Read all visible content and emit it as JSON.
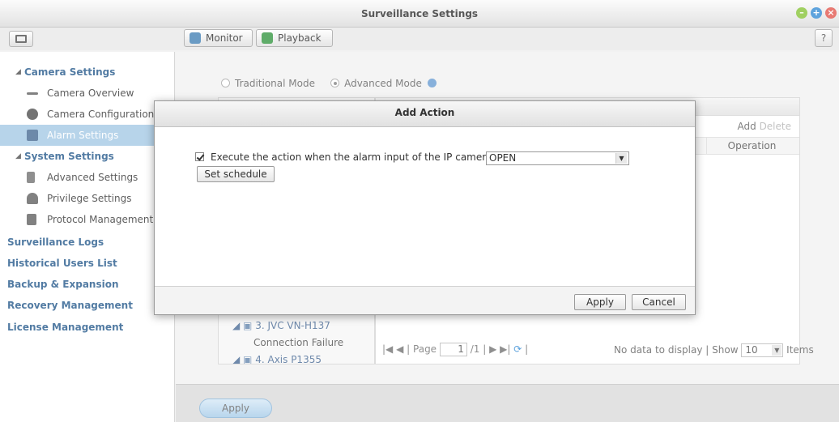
{
  "window": {
    "title": "Surveillance Settings",
    "help_label": "?"
  },
  "toolbar": {
    "monitor_label": "Monitor",
    "playback_label": "Playback"
  },
  "sidebar": {
    "items": [
      {
        "label": "Camera Settings",
        "kind": "group"
      },
      {
        "label": "Camera Overview",
        "kind": "child",
        "icon": "list-icon"
      },
      {
        "label": "Camera Configuration",
        "kind": "child",
        "icon": "camera-icon"
      },
      {
        "label": "Alarm Settings",
        "kind": "child",
        "icon": "alarm-icon",
        "active": true
      },
      {
        "label": "System Settings",
        "kind": "group"
      },
      {
        "label": "Advanced Settings",
        "kind": "child",
        "icon": "wrench-icon"
      },
      {
        "label": "Privilege Settings",
        "kind": "child",
        "icon": "user-icon"
      },
      {
        "label": "Protocol Management",
        "kind": "child",
        "icon": "network-icon"
      },
      {
        "label": "Surveillance Logs",
        "kind": "top"
      },
      {
        "label": "Historical Users List",
        "kind": "top"
      },
      {
        "label": "Backup & Expansion",
        "kind": "top"
      },
      {
        "label": "Recovery Management",
        "kind": "top"
      },
      {
        "label": "License Management",
        "kind": "top"
      }
    ]
  },
  "main": {
    "mode_traditional": "Traditional Mode",
    "mode_advanced": "Advanced Mode",
    "add_label": "Add",
    "delete_label": "Delete",
    "operation_header": "Operation",
    "tree": {
      "camera3": "3. JVC VN-H137",
      "camera3_status": "Connection Failure",
      "camera4": "4. Axis P1355"
    },
    "pager": {
      "page_label": "Page",
      "page_value": "1",
      "page_total": "/1"
    },
    "nodata": "No data to display",
    "show_label": "Show",
    "show_value": "10",
    "items_label": "Items",
    "apply_label": "Apply"
  },
  "dialog": {
    "title": "Add Action",
    "execute_label": "Execute the action when the alarm input of the IP camera is",
    "state_value": "OPEN",
    "schedule_label": "Set schedule",
    "apply_label": "Apply",
    "cancel_label": "Cancel"
  },
  "colors": {
    "accent": "#2c5f8f",
    "active_row": "#a8cbe6",
    "min": "#8cc63f",
    "max": "#3b8fd6",
    "close": "#e35d55"
  }
}
